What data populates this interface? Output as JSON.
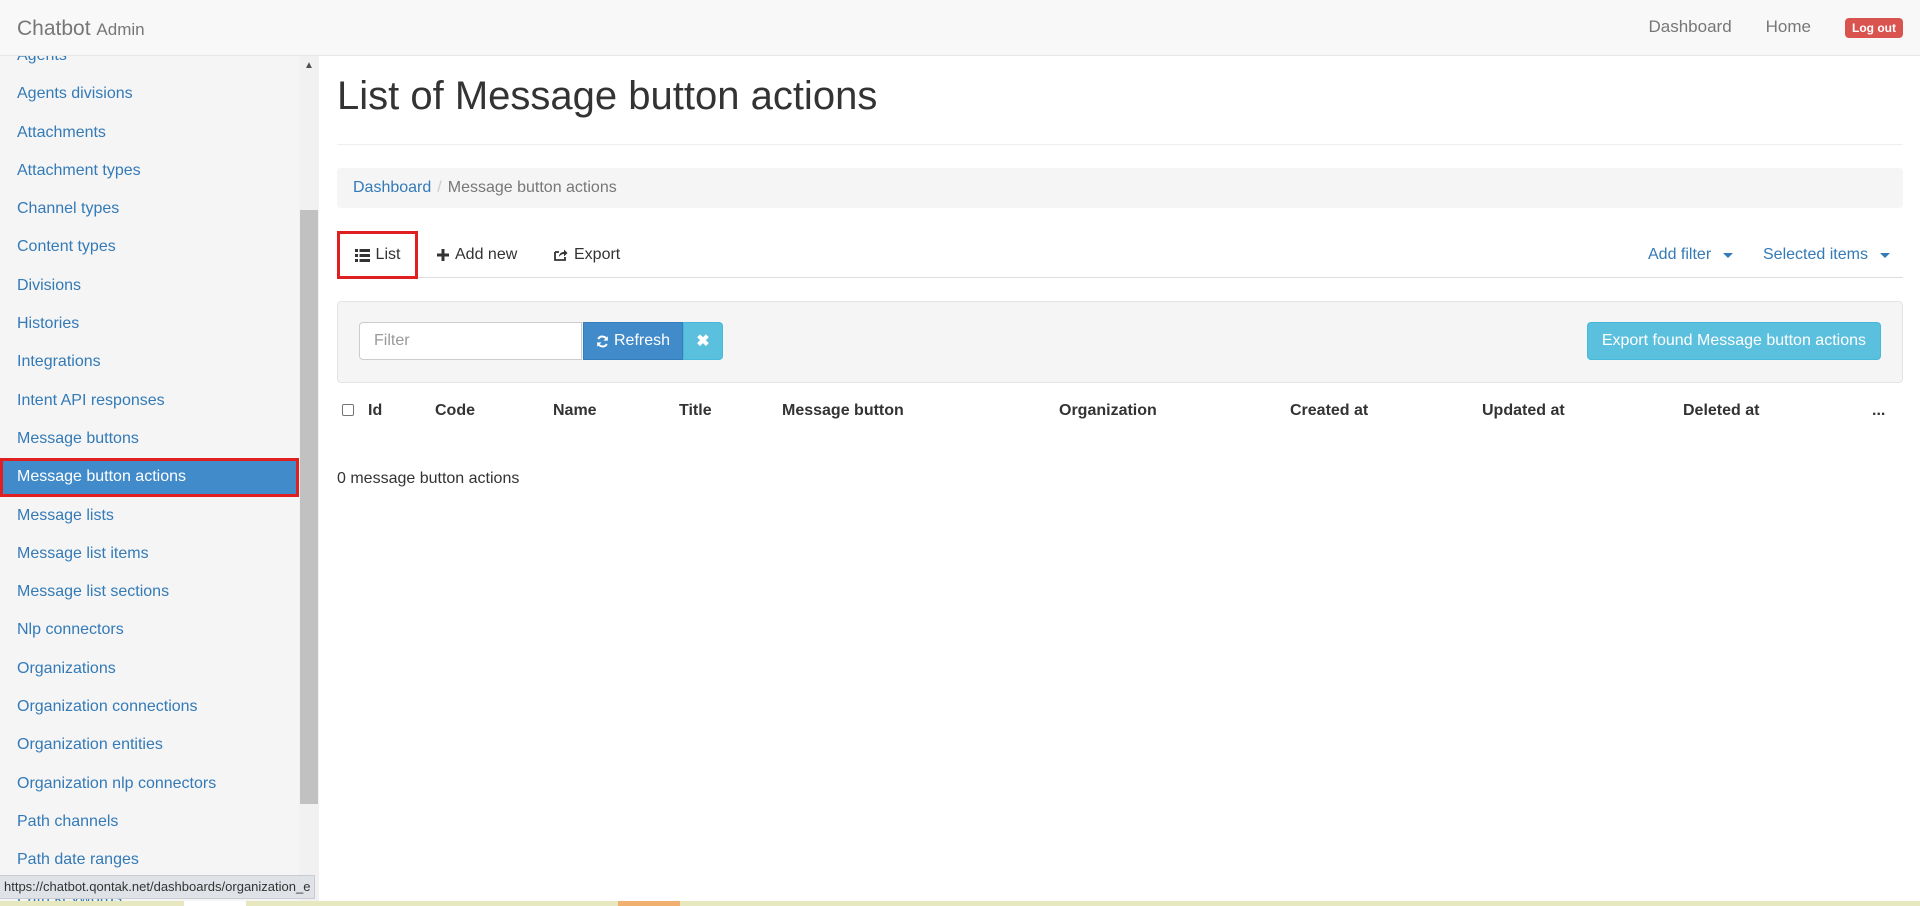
{
  "navbar": {
    "brand": "Chatbot",
    "brand_sub": "Admin",
    "links": [
      "Dashboard",
      "Home"
    ],
    "logout_label": "Log out"
  },
  "sidebar": {
    "items": [
      {
        "label": "Agents",
        "active": false
      },
      {
        "label": "Agents divisions",
        "active": false
      },
      {
        "label": "Attachments",
        "active": false
      },
      {
        "label": "Attachment types",
        "active": false
      },
      {
        "label": "Channel types",
        "active": false
      },
      {
        "label": "Content types",
        "active": false
      },
      {
        "label": "Divisions",
        "active": false
      },
      {
        "label": "Histories",
        "active": false
      },
      {
        "label": "Integrations",
        "active": false
      },
      {
        "label": "Intent API responses",
        "active": false
      },
      {
        "label": "Message buttons",
        "active": false
      },
      {
        "label": "Message button actions",
        "active": true
      },
      {
        "label": "Message lists",
        "active": false
      },
      {
        "label": "Message list items",
        "active": false
      },
      {
        "label": "Message list sections",
        "active": false
      },
      {
        "label": "Nlp connectors",
        "active": false
      },
      {
        "label": "Organizations",
        "active": false
      },
      {
        "label": "Organization connections",
        "active": false
      },
      {
        "label": "Organization entities",
        "active": false
      },
      {
        "label": "Organization nlp connectors",
        "active": false
      },
      {
        "label": "Path channels",
        "active": false
      },
      {
        "label": "Path date ranges",
        "active": false
      },
      {
        "label": "Path keywords",
        "active": false
      }
    ]
  },
  "page": {
    "title": "List of Message button actions",
    "breadcrumb": {
      "home": "Dashboard",
      "separator": "/",
      "current": "Message button actions"
    }
  },
  "tabs": {
    "list_label": "List",
    "add_label": "Add new",
    "export_label": "Export",
    "add_filter_label": "Add filter",
    "selected_items_label": "Selected items"
  },
  "filter": {
    "placeholder": "Filter",
    "value": "",
    "refresh_label": "Refresh",
    "clear_glyph": "✖",
    "export_found_label": "Export found Message button actions"
  },
  "table": {
    "columns": [
      "Id",
      "Code",
      "Name",
      "Title",
      "Message button",
      "Organization",
      "Created at",
      "Updated at",
      "Deleted at",
      "..."
    ],
    "rows": [],
    "count_text": "0 message button actions"
  },
  "statusbar": {
    "url": "https://chatbot.qontak.net/dashboards/organization_e"
  },
  "colors": {
    "link": "#337ab7",
    "active_bg": "#428bca",
    "highlight": "#e02020",
    "logout": "#d9534f",
    "info": "#5bc0de"
  }
}
